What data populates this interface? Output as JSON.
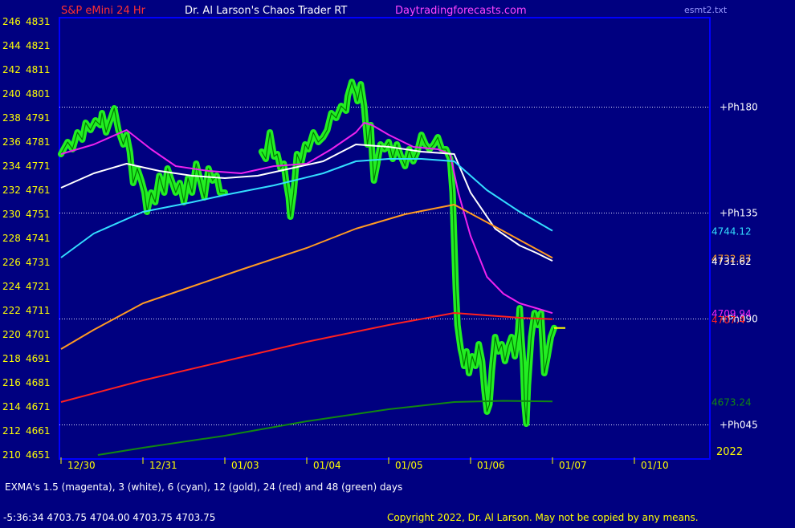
{
  "header": {
    "symbol": "S&P eMini 24 Hr",
    "title": "Dr. Al Larson's Chaos Trader RT",
    "site": "Daytradingforecasts.com",
    "file": "esmt2.txt"
  },
  "footer": {
    "legend_note": "EXMA's 1.5 (magenta), 3 (white), 6 (cyan), 12 (gold),  24  (red)  and 48 (green) days",
    "quote": "-5:36:34  4703.75 4704.00 4703.75 4703.75",
    "copyright": "Copyright 2022, Dr. Al Larson. May not be copied by any means."
  },
  "colors": {
    "background": "#000080",
    "plot_background": "#000080",
    "frame": "#0000ff",
    "axis_text": "#ffff00",
    "price": "#22ee22",
    "price_core": "#007700",
    "magenta": "#ee22ee",
    "white": "#ffffff",
    "cyan": "#33ddff",
    "gold": "#ff9a22",
    "red": "#ff2020",
    "green": "#118811",
    "symbol_text": "#ff3030",
    "site_text": "#ff44ff"
  },
  "chart_data": {
    "type": "line",
    "y_left_ticks": [
      "246",
      "244",
      "242",
      "240",
      "238",
      "236",
      "234",
      "232",
      "230",
      "228",
      "226",
      "224",
      "222",
      "220",
      "218",
      "216",
      "214",
      "212",
      "210"
    ],
    "y_right_ticks": [
      "4831",
      "4821",
      "4811",
      "4801",
      "4791",
      "4781",
      "4771",
      "4761",
      "4751",
      "4741",
      "4731",
      "4721",
      "4711",
      "4701",
      "4691",
      "4681",
      "4671",
      "4661",
      "4651"
    ],
    "ylim": [
      4651,
      4831
    ],
    "x_labels": [
      "12/30",
      "12/31",
      "01/03",
      "01/04",
      "01/05",
      "01/06",
      "01/07",
      "01/10"
    ],
    "xlim": [
      0,
      8
    ],
    "year_label": "2022",
    "levels": [
      {
        "label": "+Ph180",
        "value": 4795.5
      },
      {
        "label": "+Ph135",
        "value": 4751.5
      },
      {
        "label": "+Ph090",
        "value": 4707.5
      },
      {
        "label": "+Ph045",
        "value": 4663.5
      }
    ],
    "value_labels": [
      {
        "text": "4744.12",
        "value": 4744.12,
        "color": "#33ddff"
      },
      {
        "text": "4732.87",
        "value": 4732.87,
        "color": "#ff9a22"
      },
      {
        "text": "4731.62",
        "value": 4731.62,
        "color": "#ffffff"
      },
      {
        "text": "4709.94",
        "value": 4709.94,
        "color": "#ee22ee"
      },
      {
        "text": "4707.4",
        "value": 4707.4,
        "color": "#ff2020"
      },
      {
        "text": "4673.24",
        "value": 4673.24,
        "color": "#118811"
      }
    ],
    "last_price": 4703.75,
    "series": [
      {
        "name": "Price",
        "color": "#22ee22",
        "style": "price",
        "points": [
          [
            0,
            4776
          ],
          [
            0.08,
            4781
          ],
          [
            0.14,
            4778
          ],
          [
            0.2,
            4785
          ],
          [
            0.26,
            4782
          ],
          [
            0.3,
            4789
          ],
          [
            0.36,
            4786
          ],
          [
            0.42,
            4790
          ],
          [
            0.48,
            4788
          ],
          [
            0.5,
            4793
          ],
          [
            0.55,
            4785
          ],
          [
            0.6,
            4790
          ],
          [
            0.65,
            4795
          ],
          [
            0.7,
            4786
          ],
          [
            0.76,
            4780
          ],
          [
            0.8,
            4784
          ],
          [
            0.84,
            4777
          ],
          [
            0.88,
            4764
          ],
          [
            0.93,
            4770
          ],
          [
            0.98,
            4765
          ],
          [
            1.02,
            4760
          ],
          [
            1.05,
            4752
          ],
          [
            1.1,
            4760
          ],
          [
            1.15,
            4756
          ],
          [
            1.2,
            4767
          ],
          [
            1.26,
            4760
          ],
          [
            1.3,
            4770
          ],
          [
            1.35,
            4765
          ],
          [
            1.4,
            4760
          ],
          [
            1.45,
            4764
          ],
          [
            1.5,
            4756
          ],
          [
            1.55,
            4766
          ],
          [
            1.6,
            4760
          ],
          [
            1.65,
            4772
          ],
          [
            1.7,
            4765
          ],
          [
            1.75,
            4758
          ],
          [
            1.8,
            4770
          ],
          [
            1.85,
            4765
          ],
          [
            1.9,
            4767
          ],
          [
            1.94,
            4760
          ],
          [
            2.0,
            4760
          ]
        ]
      },
      {
        "name": "Price",
        "color": "#22ee22",
        "style": "price",
        "points": [
          [
            2.45,
            4777
          ],
          [
            2.5,
            4774
          ],
          [
            2.55,
            4785
          ],
          [
            2.6,
            4775
          ],
          [
            2.64,
            4776
          ],
          [
            2.68,
            4770
          ],
          [
            2.72,
            4772
          ],
          [
            2.75,
            4764
          ],
          [
            2.78,
            4758
          ],
          [
            2.8,
            4750
          ],
          [
            2.84,
            4760
          ],
          [
            2.88,
            4776
          ],
          [
            2.93,
            4772
          ],
          [
            2.98,
            4780
          ],
          [
            3.02,
            4778
          ],
          [
            3.08,
            4785
          ],
          [
            3.14,
            4781
          ],
          [
            3.2,
            4783
          ],
          [
            3.25,
            4786
          ],
          [
            3.3,
            4793
          ],
          [
            3.36,
            4791
          ],
          [
            3.42,
            4796
          ],
          [
            3.48,
            4794
          ],
          [
            3.5,
            4800
          ],
          [
            3.55,
            4806
          ],
          [
            3.6,
            4801
          ],
          [
            3.62,
            4798
          ],
          [
            3.66,
            4805
          ],
          [
            3.7,
            4796
          ],
          [
            3.74,
            4780
          ],
          [
            3.78,
            4788
          ],
          [
            3.8,
            4775
          ],
          [
            3.82,
            4765
          ],
          [
            3.86,
            4772
          ],
          [
            3.9,
            4780
          ],
          [
            3.95,
            4778
          ],
          [
            4.0,
            4781
          ],
          [
            4.05,
            4774
          ],
          [
            4.1,
            4780
          ],
          [
            4.15,
            4775
          ],
          [
            4.2,
            4771
          ],
          [
            4.25,
            4778
          ],
          [
            4.3,
            4773
          ],
          [
            4.35,
            4777
          ],
          [
            4.4,
            4784
          ],
          [
            4.45,
            4780
          ],
          [
            4.5,
            4778
          ],
          [
            4.55,
            4780
          ],
          [
            4.6,
            4783
          ],
          [
            4.65,
            4778
          ],
          [
            4.7,
            4778
          ],
          [
            4.75,
            4774
          ],
          [
            4.78,
            4760
          ],
          [
            4.8,
            4740
          ],
          [
            4.82,
            4720
          ],
          [
            4.84,
            4705
          ],
          [
            4.86,
            4700
          ],
          [
            4.88,
            4695
          ],
          [
            4.9,
            4692
          ],
          [
            4.92,
            4688
          ],
          [
            4.95,
            4694
          ],
          [
            4.98,
            4685
          ],
          [
            5.02,
            4692
          ],
          [
            5.06,
            4688
          ],
          [
            5.1,
            4697
          ],
          [
            5.14,
            4690
          ],
          [
            5.17,
            4678
          ],
          [
            5.2,
            4669
          ],
          [
            5.23,
            4672
          ],
          [
            5.26,
            4686
          ],
          [
            5.3,
            4700
          ],
          [
            5.34,
            4694
          ],
          [
            5.38,
            4697
          ],
          [
            5.42,
            4690
          ],
          [
            5.46,
            4696
          ],
          [
            5.5,
            4700
          ],
          [
            5.54,
            4692
          ],
          [
            5.58,
            4702
          ],
          [
            5.6,
            4712
          ],
          [
            5.62,
            4700
          ],
          [
            5.64,
            4690
          ],
          [
            5.66,
            4672
          ],
          [
            5.68,
            4664
          ],
          [
            5.7,
            4680
          ],
          [
            5.74,
            4700
          ],
          [
            5.78,
            4710
          ],
          [
            5.82,
            4705
          ],
          [
            5.86,
            4710
          ],
          [
            5.9,
            4685
          ],
          [
            5.94,
            4692
          ],
          [
            5.98,
            4700
          ],
          [
            6.02,
            4703.75
          ]
        ]
      },
      {
        "name": "EXMA 1.5 (magenta)",
        "color": "#ee22ee",
        "style": "line",
        "points": [
          [
            0,
            4776
          ],
          [
            0.4,
            4780
          ],
          [
            0.8,
            4786
          ],
          [
            1.1,
            4778
          ],
          [
            1.4,
            4771
          ],
          [
            1.8,
            4769
          ],
          [
            2.2,
            4768
          ],
          [
            2.6,
            4771
          ],
          [
            3.0,
            4772
          ],
          [
            3.3,
            4778
          ],
          [
            3.6,
            4785
          ],
          [
            3.7,
            4789
          ],
          [
            3.8,
            4788
          ],
          [
            4.0,
            4784
          ],
          [
            4.3,
            4779
          ],
          [
            4.6,
            4778
          ],
          [
            4.75,
            4776
          ],
          [
            4.85,
            4760
          ],
          [
            5.0,
            4742
          ],
          [
            5.2,
            4725
          ],
          [
            5.4,
            4718
          ],
          [
            5.6,
            4714
          ],
          [
            5.8,
            4712
          ],
          [
            6.0,
            4709.94
          ]
        ]
      },
      {
        "name": "EXMA 3 (white)",
        "color": "#ffffff",
        "style": "line",
        "points": [
          [
            0,
            4762
          ],
          [
            0.4,
            4768
          ],
          [
            0.8,
            4772
          ],
          [
            1.2,
            4769
          ],
          [
            1.6,
            4767
          ],
          [
            2.0,
            4766
          ],
          [
            2.4,
            4767
          ],
          [
            2.8,
            4770
          ],
          [
            3.2,
            4773
          ],
          [
            3.6,
            4780
          ],
          [
            4.0,
            4779
          ],
          [
            4.4,
            4777
          ],
          [
            4.8,
            4776
          ],
          [
            5.0,
            4760
          ],
          [
            5.3,
            4745
          ],
          [
            5.6,
            4738
          ],
          [
            5.8,
            4735
          ],
          [
            6.0,
            4731.62
          ]
        ]
      },
      {
        "name": "EXMA 6 (cyan)",
        "color": "#33ddff",
        "style": "line",
        "points": [
          [
            0,
            4733
          ],
          [
            0.4,
            4743
          ],
          [
            1.0,
            4752
          ],
          [
            1.6,
            4756
          ],
          [
            2.0,
            4759
          ],
          [
            2.6,
            4763
          ],
          [
            3.2,
            4768
          ],
          [
            3.6,
            4773
          ],
          [
            4.0,
            4774
          ],
          [
            4.4,
            4774
          ],
          [
            4.8,
            4773
          ],
          [
            5.2,
            4761
          ],
          [
            5.6,
            4752
          ],
          [
            6.0,
            4744.12
          ]
        ]
      },
      {
        "name": "EXMA 12 (gold)",
        "color": "#ff9a22",
        "style": "line",
        "points": [
          [
            0,
            4695
          ],
          [
            0.4,
            4703
          ],
          [
            1.0,
            4714
          ],
          [
            1.6,
            4721
          ],
          [
            2.2,
            4728
          ],
          [
            3.0,
            4737
          ],
          [
            3.6,
            4745
          ],
          [
            4.2,
            4751
          ],
          [
            4.8,
            4755
          ],
          [
            5.4,
            4744
          ],
          [
            6.0,
            4732.87
          ]
        ]
      },
      {
        "name": "EXMA 24 (red)",
        "color": "#ff2020",
        "style": "line",
        "points": [
          [
            0,
            4673
          ],
          [
            1.0,
            4682
          ],
          [
            2.0,
            4690
          ],
          [
            3.0,
            4698
          ],
          [
            4.0,
            4705
          ],
          [
            4.8,
            4710
          ],
          [
            5.2,
            4709
          ],
          [
            5.6,
            4708
          ],
          [
            6.0,
            4707.4
          ]
        ]
      },
      {
        "name": "EXMA 48 (green)",
        "color": "#118811",
        "style": "line",
        "points": [
          [
            0.45,
            4651
          ],
          [
            1.0,
            4654
          ],
          [
            2.0,
            4659
          ],
          [
            3.0,
            4665
          ],
          [
            4.0,
            4670
          ],
          [
            4.8,
            4673
          ],
          [
            5.4,
            4673.5
          ],
          [
            6.0,
            4673.24
          ]
        ]
      }
    ]
  }
}
